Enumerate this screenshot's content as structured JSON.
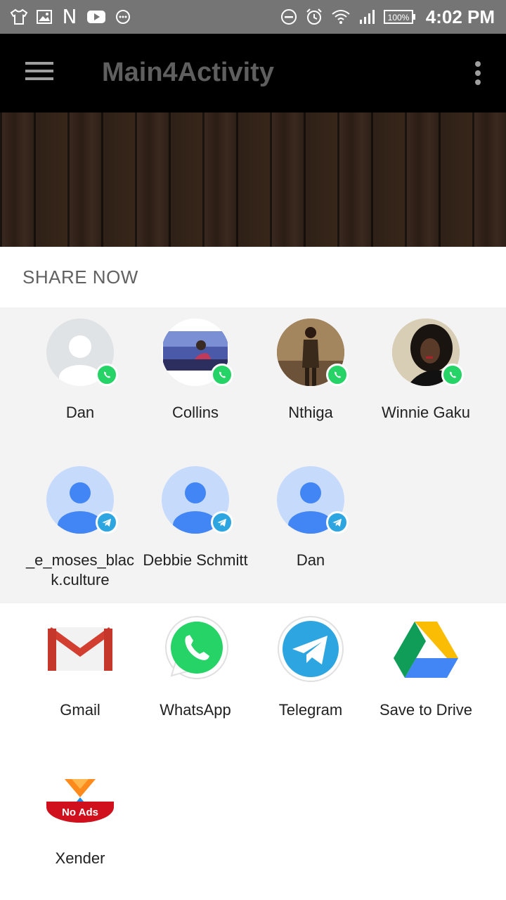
{
  "status_bar": {
    "left_icons": [
      "tshirt-icon",
      "image-icon",
      "n-icon",
      "youtube-icon",
      "chat-icon"
    ],
    "n_glyph": "N",
    "right_icons": [
      "dnd-icon",
      "alarm-icon",
      "wifi-icon",
      "signal-icon",
      "battery-icon"
    ],
    "battery": "100%",
    "time": "4:02 PM"
  },
  "toolbar": {
    "title": "Main4Activity",
    "menu_icon": "hamburger-menu-icon",
    "overflow_icon": "overflow-menu-icon"
  },
  "share_sheet": {
    "title": "SHARE NOW",
    "direct_targets": [
      {
        "label": "Dan",
        "badge": "whatsapp"
      },
      {
        "label": "Collins",
        "badge": "whatsapp"
      },
      {
        "label": "Nthiga",
        "badge": "whatsapp"
      },
      {
        "label": "Winnie Gaku",
        "badge": "whatsapp"
      },
      {
        "label": "_e_moses_blac\nk.culture",
        "badge": "telegram"
      },
      {
        "label": "Debbie Schmitt",
        "badge": "telegram"
      },
      {
        "label": "Dan",
        "badge": "telegram"
      }
    ],
    "apps": [
      {
        "label": "Gmail",
        "icon": "gmail-icon"
      },
      {
        "label": "WhatsApp",
        "icon": "whatsapp-icon"
      },
      {
        "label": "Telegram",
        "icon": "telegram-icon"
      },
      {
        "label": "Save to Drive",
        "icon": "google-drive-icon"
      },
      {
        "label": "Xender",
        "icon": "xender-icon",
        "badge_text": "No Ads"
      }
    ]
  },
  "colors": {
    "status_bar": "#757575",
    "toolbar": "#000000",
    "direct_share_bg": "#f3f3f3",
    "whatsapp": "#25d366",
    "telegram": "#2ca5e0"
  }
}
